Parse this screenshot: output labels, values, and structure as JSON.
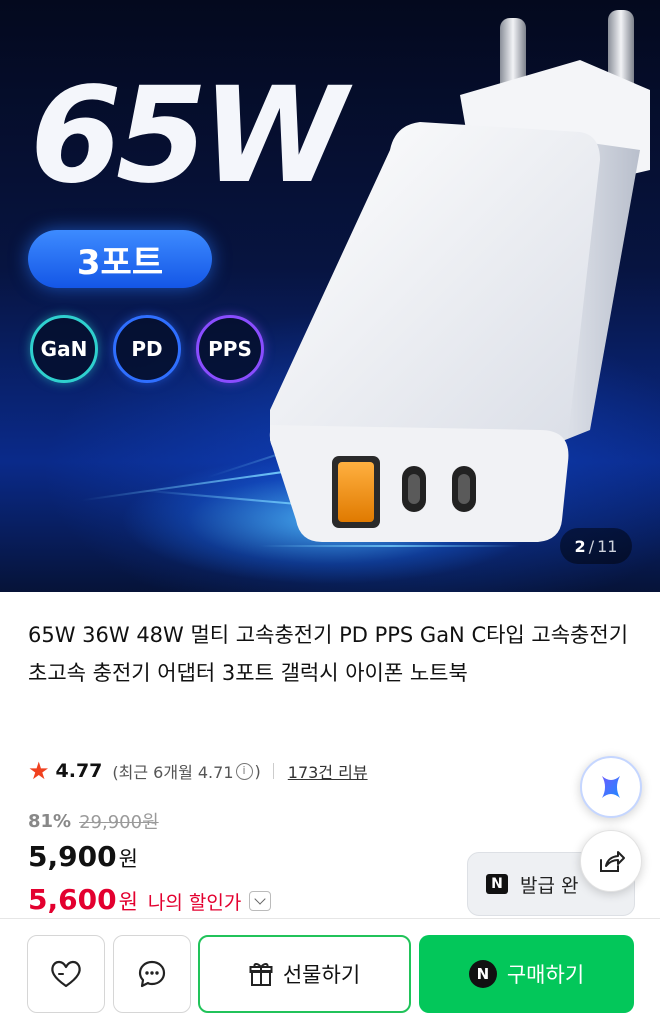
{
  "hero": {
    "headline": "65W",
    "ports_label": "3포트",
    "badges": [
      "GaN",
      "PD",
      "PPS"
    ],
    "image_counter": {
      "current": "2",
      "separator": "/",
      "total": "11"
    }
  },
  "product": {
    "title": "65W 36W 48W 멀티 고속충전기 PD PPS GaN C타입 고속충전기 초고속 충전기 어댑터 3포트 갤럭시 아이폰 노트북",
    "rating": {
      "score": "4.77",
      "recent_prefix": "(최근 6개월 4.71",
      "recent_suffix": ")",
      "review_count": "173건 리뷰"
    },
    "pricing": {
      "discount_percent": "81%",
      "original_price": "29,900원",
      "price": "5,900",
      "price_unit": "원",
      "my_price": "5,600",
      "my_price_unit": "원",
      "my_price_label": "나의 할인가"
    },
    "coupon_button": "발급 완"
  },
  "bottom_bar": {
    "gift_label": "선물하기",
    "buy_label": "구매하기",
    "naver_mark": "N"
  },
  "colors": {
    "naver_green": "#03c75a",
    "sale_red": "#e3002f",
    "star": "#f0411f"
  },
  "icons": [
    "star-icon",
    "info-icon",
    "chevron-down-icon",
    "sparkle-ai-icon",
    "share-icon",
    "heart-icon",
    "chat-icon",
    "gift-icon",
    "naver-icon"
  ]
}
